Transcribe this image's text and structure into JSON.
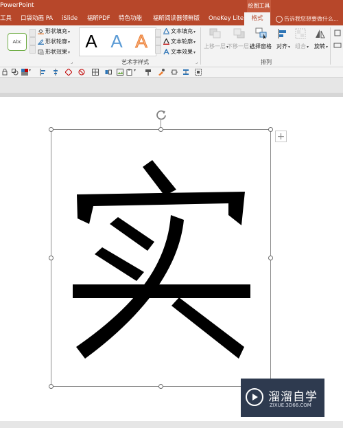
{
  "window": {
    "app_title": "PowerPoint",
    "contextual_group": "绘图工具"
  },
  "tabs": [
    {
      "label": "工具",
      "active": false
    },
    {
      "label": "口袋动画 PA",
      "active": false
    },
    {
      "label": "iSlide",
      "active": false
    },
    {
      "label": "福昕PDF",
      "active": false
    },
    {
      "label": "特色功能",
      "active": false
    },
    {
      "label": "福昕阅读器领鲜版",
      "active": false
    },
    {
      "label": "OneKey Lite",
      "active": false
    },
    {
      "label": "格式",
      "active": true
    }
  ],
  "tell_me": "告诉我您想要做什么...",
  "ribbon": {
    "shape_style_sample": "Abc",
    "shape_fill": "形状填充",
    "shape_outline": "形状轮廓",
    "shape_effects": "形状效果",
    "wordart_samples": [
      "A",
      "A",
      "A"
    ],
    "wordart_colors": [
      "#000000",
      "#5b9bd5",
      "#ed7d31"
    ],
    "text_fill": "文本填充",
    "text_outline": "文本轮廓",
    "text_effects": "文本效果",
    "wordart_group_label": "艺术字样式",
    "bring_forward": "上移一层",
    "send_backward": "下移一层",
    "selection_pane": "选择窗格",
    "align": "对齐",
    "group": "组合",
    "rotate": "旋转",
    "arrange_group_label": "排列"
  },
  "slide": {
    "character": "实"
  },
  "watermark": {
    "title": "溜溜自学",
    "url": "ZIXUE.3D66.COM"
  },
  "colors": {
    "accent": "#b7472a",
    "ribbon_bg": "#f3f3f3",
    "watermark_bg": "#2e3a4f"
  }
}
